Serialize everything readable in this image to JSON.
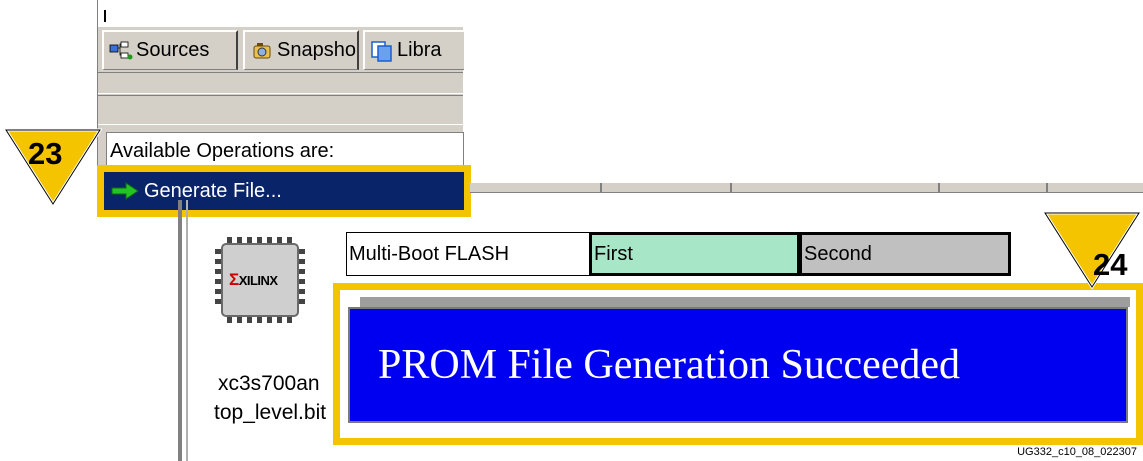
{
  "tabs": [
    {
      "label": "Sources",
      "icon": "sources-icon"
    },
    {
      "label": "Snapsho",
      "icon": "snapshot-icon"
    },
    {
      "label": "Libra",
      "icon": "libraries-icon"
    }
  ],
  "operations": {
    "label": "Available Operations are:",
    "items": [
      {
        "label": "Generate File...",
        "icon": "green-arrow-icon"
      }
    ]
  },
  "device": {
    "logo": "XILINX",
    "name": "xc3s700an",
    "bitfile": "top_level.bit"
  },
  "flash_table": {
    "cells": [
      "Multi-Boot FLASH",
      "First",
      "Second"
    ]
  },
  "status": {
    "message": "PROM File Generation Succeeded"
  },
  "callouts": [
    "23",
    "24"
  ],
  "figure_code": "UG332_c10_08_022307",
  "colors": {
    "highlight_frame": "#f5c400",
    "selection": "#0a246a",
    "success_banner": "#0000f0",
    "first_cell": "#a8e6c8",
    "second_cell": "#c0c0c0"
  }
}
